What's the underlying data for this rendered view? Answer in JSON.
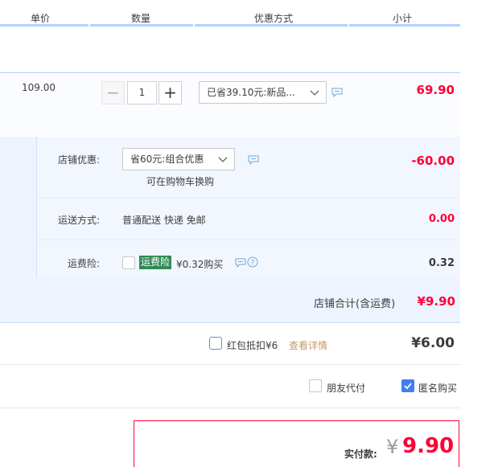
{
  "header": {
    "col_unit_price": "单价",
    "col_quantity": "数量",
    "col_discount": "优惠方式",
    "col_subtotal": "小计"
  },
  "item": {
    "unit_price": "109.00",
    "quantity": "1",
    "qty_minus": "−",
    "qty_plus": "+",
    "discount_select": "已省39.10元:新品...",
    "subtotal": "69.90"
  },
  "shop": {
    "discount_label": "店铺优惠:",
    "discount_select": "省60元:组合优惠",
    "discount_hint": "可在购物车换购",
    "discount_amount": "-60.00",
    "shipping_label": "运送方式:",
    "shipping_value": "普通配送 快递 免邮",
    "shipping_amount": "0.00",
    "insurance_label": "运费险:",
    "insurance_tag": "运费险",
    "insurance_price": "¥0.32购买",
    "insurance_amount": "0.32",
    "total_label": "店铺合计(含运费)",
    "total_amount": "¥9.90"
  },
  "redpacket": {
    "label": "红包抵扣¥6",
    "details_link": "查看详情",
    "amount": "¥6.00"
  },
  "options": {
    "friend_pay": "朋友代付",
    "anonymous": "匿名购买",
    "anonymous_checked": true
  },
  "payment": {
    "label": "实付款:",
    "currency": "¥",
    "amount": "9.90"
  },
  "colors": {
    "accent_red": "#ff0036",
    "header_line": "#b2d1ff",
    "panel_bg": "#eef4ff",
    "check_blue": "#3f7fef",
    "link_orange": "#c59a66"
  }
}
